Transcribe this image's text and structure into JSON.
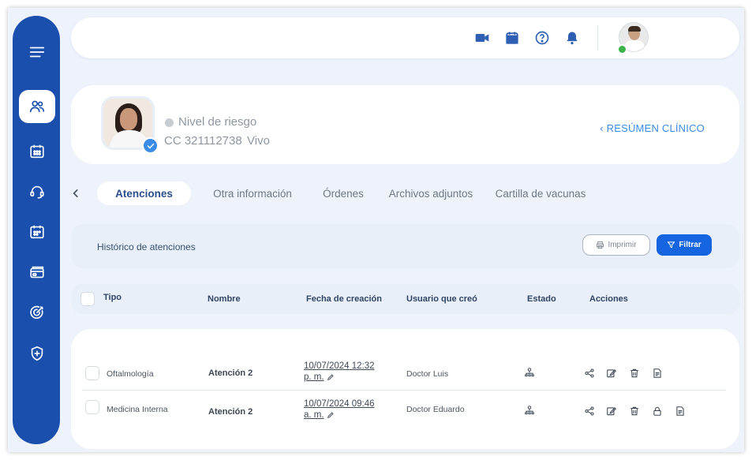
{
  "topbar": {
    "icons": [
      "video-camera-icon",
      "calendar-icon",
      "help-icon",
      "bell-icon"
    ]
  },
  "sidebar": {
    "items": [
      "menu-icon",
      "users-icon",
      "calendar-icon",
      "headset-icon",
      "schedule-icon",
      "payment-icon",
      "target-icon",
      "shield-icon"
    ],
    "active": "users-icon",
    "colors": {
      "bg": "#1a4fad",
      "active_bg": "#ffffff"
    }
  },
  "patient": {
    "risk_label": "Nivel de riesgo",
    "document": "CC 321112738",
    "status": "Vivo",
    "summary_link": "‹ RESÚMEN CLÍNICO"
  },
  "tabs": [
    {
      "label": "Atenciones",
      "active": true
    },
    {
      "label": "Otra información",
      "active": false
    },
    {
      "label": "Órdenes",
      "active": false
    },
    {
      "label": "Archivos adjuntos",
      "active": false
    },
    {
      "label": "Cartilla de vacunas",
      "active": false
    }
  ],
  "history": {
    "title": "Histórico de atenciones",
    "print_label": "Imprimir",
    "filter_label": "Filtrar"
  },
  "table": {
    "columns": [
      "Tipo",
      "Nombre",
      "Fecha de creación",
      "Usuario que creó",
      "Estado",
      "Acciones"
    ],
    "rows": [
      {
        "tipo": "Oftalmología",
        "nombre": "Atención 2",
        "fecha_1": "10/07/2024 12:32",
        "fecha_2": "p. m.",
        "usuario": "Doctor Luis",
        "actions": [
          "share-icon",
          "edit-icon",
          "trash-icon",
          "document-icon"
        ]
      },
      {
        "tipo": "Medicina Interna",
        "nombre": "Atención 2",
        "fecha_1": "10/07/2024 09:46",
        "fecha_2": "a. m.",
        "usuario": "Doctor Eduardo",
        "actions": [
          "share-icon",
          "edit-icon",
          "trash-icon",
          "lock-icon",
          "document-icon"
        ]
      }
    ]
  },
  "colors": {
    "accent": "#1565e0",
    "link": "#3b8ce8",
    "background": "#eef3fb",
    "online": "#3bb54a"
  }
}
